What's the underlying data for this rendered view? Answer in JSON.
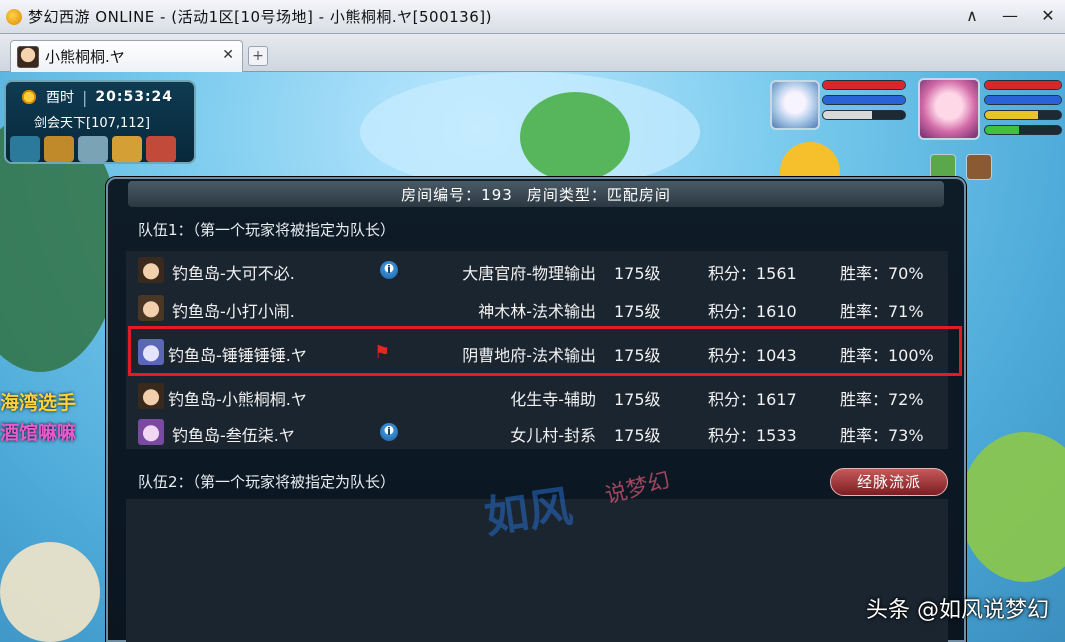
{
  "window": {
    "title": "梦幻西游 ONLINE - (活动1区[10号场地] - 小熊桐桐.ヤ[500136])",
    "controls": [
      "∧",
      "—",
      "✕"
    ]
  },
  "tabs": [
    {
      "label": "小熊桐桐.ヤ",
      "close": "✕"
    }
  ],
  "tab_add": "+",
  "hud": {
    "period": "酉时",
    "separator": "|",
    "clock": "20:53:24",
    "location": "剑会天下[107,112]"
  },
  "side_texts": [
    "海湾选手",
    "酒馆嘛嘛"
  ],
  "room": {
    "number_label": "房间编号：193",
    "type_label": "房间类型：匹配房间",
    "team1_title": "队伍1：（第一个玩家将被指定为队长）",
    "team2_title": "队伍2：（第一个玩家将被指定为队长）",
    "meridian_button": "经脉流派",
    "members": [
      {
        "name": "钓鱼岛-大可不必.",
        "badge": "i",
        "school": "大唐官府-物理输出",
        "level": "175级",
        "score": "积分：1561",
        "winrate": "胜率：70%",
        "avatar_color": "#3a2a1d"
      },
      {
        "name": "钓鱼岛-小打小闹.",
        "badge": "",
        "school": "神木林-法术输出",
        "level": "175级",
        "score": "积分：1610",
        "winrate": "胜率：71%",
        "avatar_color": "#4a3624"
      },
      {
        "name": "钓鱼岛-锤锤锤锤.ヤ",
        "badge": "",
        "flag": "⚑",
        "school": "阴曹地府-法术输出",
        "level": "175级",
        "score": "积分：1043",
        "winrate": "胜率：100%",
        "avatar_color": "#5a66b8"
      },
      {
        "name": "钓鱼岛-小熊桐桐.ヤ",
        "badge": "",
        "school": "化生寺-辅助",
        "level": "175级",
        "score": "积分：1617",
        "winrate": "胜率：72%",
        "avatar_color": "#3a2a1d"
      },
      {
        "name": "钓鱼岛-叁伍柒.ヤ",
        "badge": "i",
        "school": "女儿村-封系",
        "level": "175级",
        "score": "积分：1533",
        "winrate": "胜率：73%",
        "avatar_color": "#7a4aa0"
      }
    ]
  },
  "watermark": {
    "main": "如风",
    "sub": "说梦幻"
  },
  "credit": "头条 @如风说梦幻",
  "colors": {
    "highlight_border": "#e21b26",
    "dialog_bg": "#0e1c28",
    "hp": "#d8262a",
    "mp": "#2a63d8"
  }
}
